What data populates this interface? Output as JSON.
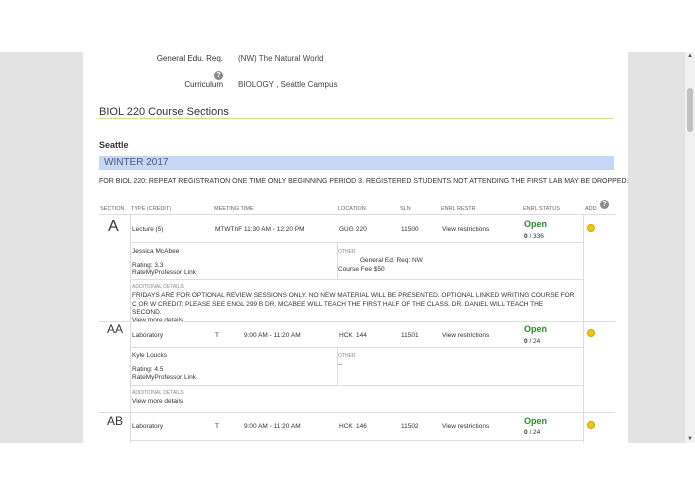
{
  "course_info": {
    "gen_edu_label": "General Edu. Req.",
    "gen_edu_value": "(NW) The Natural World",
    "curriculum_label": "Curriculum",
    "curriculum_value": "BIOLOGY , Seattle Campus"
  },
  "sections_title": "BIOL 220 Course Sections",
  "campus": "Seattle",
  "quarter": "WINTER 2017",
  "notice": "FOR BIOL 220: REPEAT REGISTRATION ONE TIME ONLY BEGINNING PERIOD 3. REGISTERED STUDENTS NOT ATTENDING THE FIRST LAB MAY BE DROPPED.",
  "table_headers": {
    "section": "SECTION",
    "type": "TYPE (CREDIT)",
    "meeting": "MEETING TIME",
    "location": "LOCATION",
    "sln": "SLN",
    "restr": "ENRL RESTR",
    "status": "ENRL STATUS",
    "add": "ADD"
  },
  "labels": {
    "other": "OTHER",
    "additional_details": "ADDITIONAL DETAILS",
    "view_restrictions": "View restrictions",
    "rmp_link": "RateMyProfessor Link",
    "view_more": "View more details"
  },
  "sections": [
    {
      "id": "A",
      "type": "Lecture (5)",
      "days": "MTWThF",
      "time": "11:30 AM - 12:20 PM",
      "building": "GUG",
      "room": "220",
      "sln": "11500",
      "status": "Open",
      "enrolled": "0",
      "capacity": "/ 336",
      "instructor": "Jessica McAbee",
      "rating": "Rating: 3.3",
      "other_line1": "General Ed. Req: NW",
      "other_line2": "Course Fee $50",
      "details_line1": "FRIDAYS ARE FOR OPTIONAL REVIEW SESSIONS ONLY. NO NEW MATERIAL WILL BE PRESENTED. OPTIONAL LINKED WRITING COURSE FOR",
      "details_line2": "C OR W CREDIT: PLEASE SEE ENGL 299 B DR. MCABEE WILL TEACH THE FIRST HALF OF THE CLASS. DR. DANIEL WILL TEACH THE",
      "details_line3": "SECOND."
    },
    {
      "id": "AA",
      "type": "Laboratory",
      "days": "T",
      "time": "9:00 AM - 11:20 AM",
      "building": "HCK",
      "room": "144",
      "sln": "11501",
      "status": "Open",
      "enrolled": "0",
      "capacity": "/ 24",
      "instructor": "Kyle Loucks",
      "rating": "Rating: 4.5",
      "other_line1": "--"
    },
    {
      "id": "AB",
      "type": "Laboratory",
      "days": "T",
      "time": "9:00 AM - 11:20 AM",
      "building": "HCK",
      "room": "146",
      "sln": "11502",
      "status": "Open",
      "enrolled": "0",
      "capacity": "/ 24"
    }
  ]
}
